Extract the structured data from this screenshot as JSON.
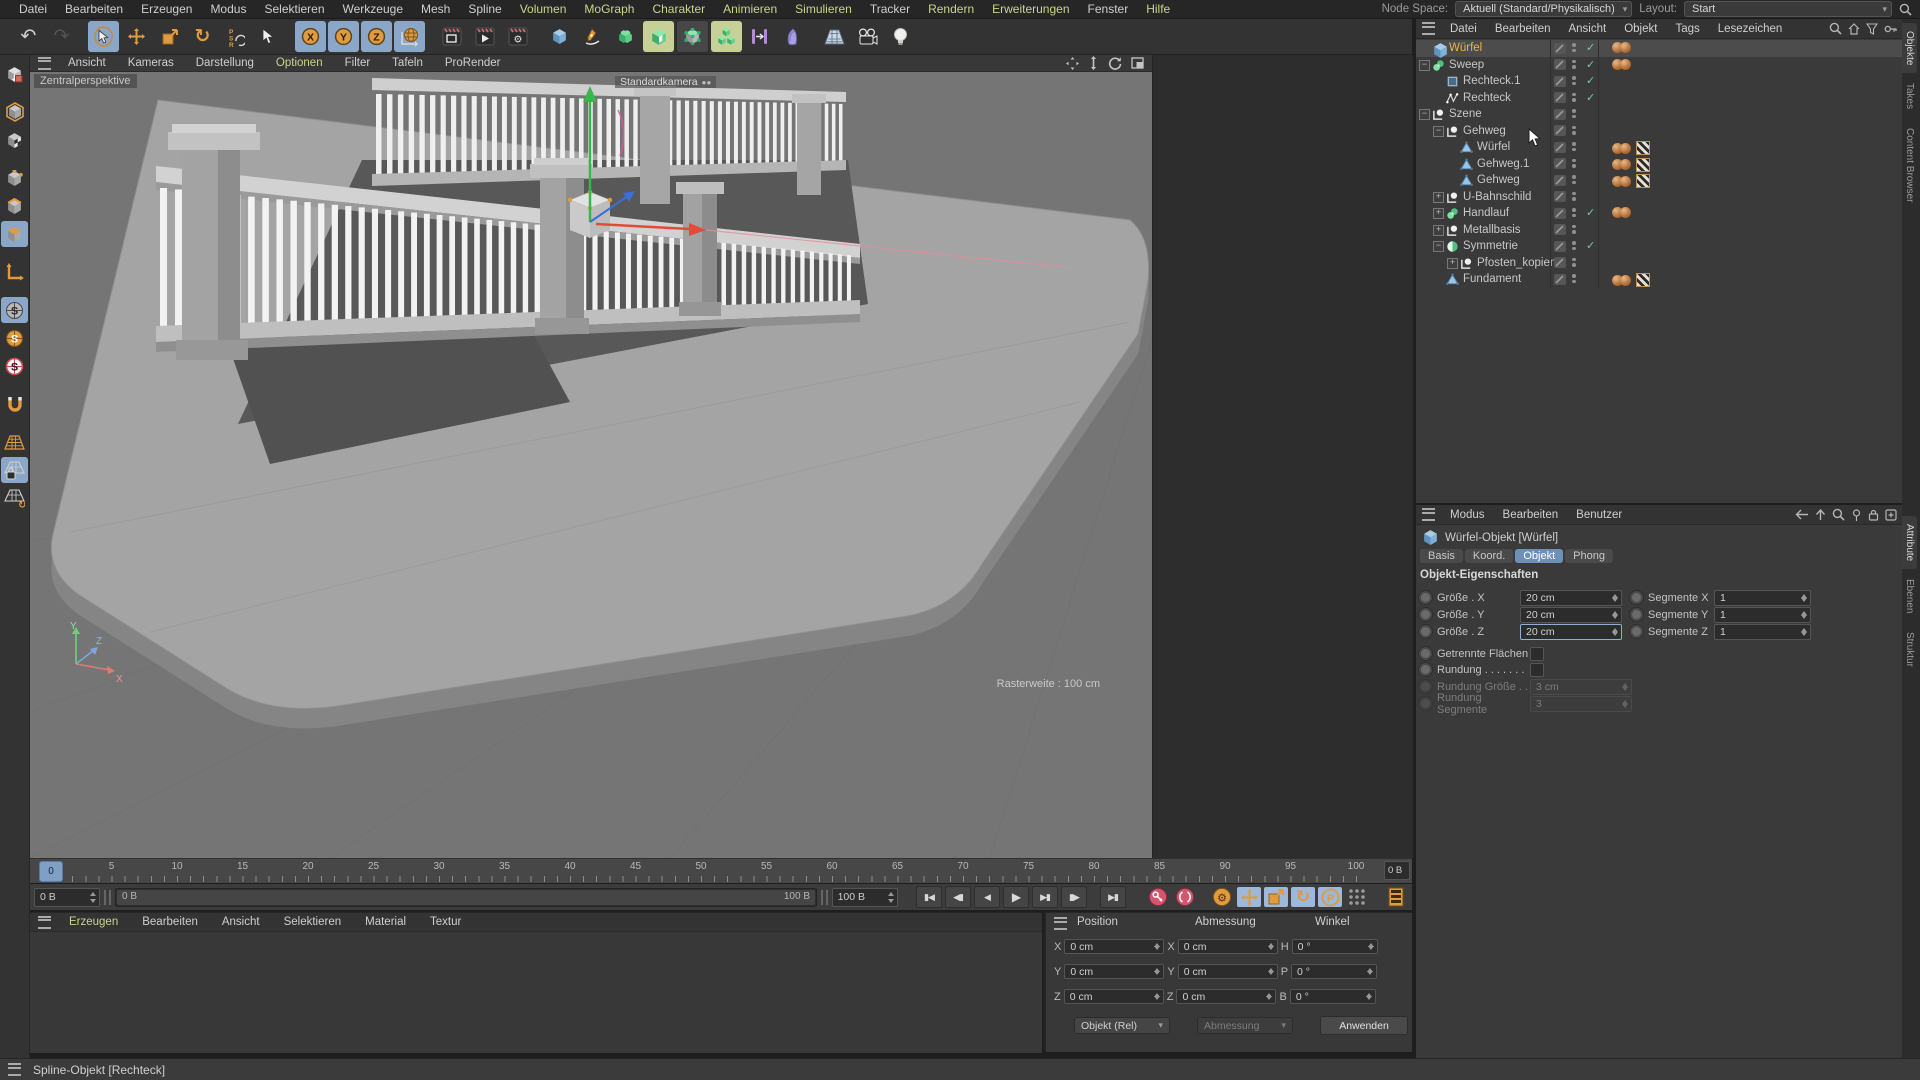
{
  "menubar": {
    "items": [
      {
        "label": "Datei",
        "hl": false
      },
      {
        "label": "Bearbeiten",
        "hl": false
      },
      {
        "label": "Erzeugen",
        "hl": false
      },
      {
        "label": "Modus",
        "hl": false
      },
      {
        "label": "Selektieren",
        "hl": false
      },
      {
        "label": "Werkzeuge",
        "hl": false
      },
      {
        "label": "Mesh",
        "hl": false
      },
      {
        "label": "Spline",
        "hl": false
      },
      {
        "label": "Volumen",
        "hl": true
      },
      {
        "label": "MoGraph",
        "hl": true
      },
      {
        "label": "Charakter",
        "hl": true
      },
      {
        "label": "Animieren",
        "hl": true
      },
      {
        "label": "Simulieren",
        "hl": true
      },
      {
        "label": "Tracker",
        "hl": false
      },
      {
        "label": "Rendern",
        "hl": true
      },
      {
        "label": "Erweiterungen",
        "hl": true
      },
      {
        "label": "Fenster",
        "hl": false
      },
      {
        "label": "Hilfe",
        "hl": true
      }
    ],
    "node_space_label": "Node Space:",
    "node_space_value": "Aktuell (Standard/Physikalisch)",
    "layout_label": "Layout:",
    "layout_value": "Start"
  },
  "toolbar": {
    "buttons": [
      {
        "icon": "undo",
        "name": "undo-button"
      },
      {
        "icon": "redo",
        "name": "redo-button",
        "dim": true
      },
      {
        "sep": true
      },
      {
        "icon": "cursor-ring",
        "name": "live-selection-tool",
        "active": "blue"
      },
      {
        "icon": "move",
        "name": "move-tool"
      },
      {
        "icon": "scale",
        "name": "scale-tool"
      },
      {
        "icon": "rotate",
        "name": "rotate-tool"
      },
      {
        "icon": "psr",
        "name": "psr-tool"
      },
      {
        "icon": "cursor",
        "name": "selection-tool"
      },
      {
        "sep": true
      },
      {
        "icon": "axis-x",
        "name": "lock-x-axis",
        "active": "blue"
      },
      {
        "icon": "axis-y",
        "name": "lock-y-axis",
        "active": "blue"
      },
      {
        "icon": "axis-z",
        "name": "lock-z-axis",
        "active": "blue"
      },
      {
        "icon": "globe",
        "name": "coordinate-system-toggle",
        "active": "blue"
      },
      {
        "sep": true
      },
      {
        "icon": "clapper-frame",
        "name": "render-view-button"
      },
      {
        "icon": "clapper-play",
        "name": "render-picture-viewer-button"
      },
      {
        "icon": "clapper-gear",
        "name": "render-settings-button"
      },
      {
        "sep": true
      },
      {
        "icon": "cube-blue",
        "name": "primitive-object-menu"
      },
      {
        "icon": "pen",
        "name": "spline-pen-menu"
      },
      {
        "icon": "cube-green-handles",
        "name": "generators-menu"
      },
      {
        "icon": "cube-green-open",
        "name": "subdivision-surface-menu",
        "active": "green"
      },
      {
        "icon": "cube-green-dots",
        "name": "deformer-menu",
        "active": "pressed"
      },
      {
        "icon": "cubes-green",
        "name": "mograph-cloner-menu",
        "active": "green"
      },
      {
        "icon": "array-purple",
        "name": "spline-modifier-menu"
      },
      {
        "icon": "bend-purple",
        "name": "bend-deformer-menu"
      },
      {
        "sep": true
      },
      {
        "icon": "floor-grid",
        "name": "environment-floor-menu"
      },
      {
        "icon": "camera",
        "name": "camera-menu"
      },
      {
        "icon": "bulb",
        "name": "light-menu"
      }
    ]
  },
  "left_toolbar": {
    "buttons": [
      {
        "icon": "make-editable",
        "name": "make-editable-button"
      },
      {
        "gap": true
      },
      {
        "icon": "model-mode",
        "name": "model-mode-button"
      },
      {
        "icon": "texture-mode",
        "name": "texture-mode-button"
      },
      {
        "gap": true
      },
      {
        "icon": "point-mode",
        "name": "point-mode-button"
      },
      {
        "icon": "edge-mode",
        "name": "edge-mode-button"
      },
      {
        "icon": "polygon-mode",
        "name": "polygon-mode-button",
        "active": "blue"
      },
      {
        "gap": true
      },
      {
        "icon": "axis-mode",
        "name": "enable-axis-button"
      },
      {
        "gap": true
      },
      {
        "icon": "snap-gray",
        "name": "enable-snap-button",
        "active": "blue"
      },
      {
        "icon": "snap-orange",
        "name": "snap-settings-button"
      },
      {
        "icon": "snap-red",
        "name": "quantize-button"
      },
      {
        "gap": true
      },
      {
        "icon": "magnet",
        "name": "magnet-snap-button"
      },
      {
        "gap": true
      },
      {
        "icon": "workplane",
        "name": "workplane-button"
      },
      {
        "icon": "workplane-lock",
        "name": "lock-workplane-button",
        "active": "blue"
      },
      {
        "icon": "workplane-rotate",
        "name": "align-workplane-button"
      }
    ]
  },
  "viewport": {
    "menu": [
      {
        "label": "Ansicht",
        "hl": false
      },
      {
        "label": "Kameras",
        "hl": false
      },
      {
        "label": "Darstellung",
        "hl": false
      },
      {
        "label": "Optionen",
        "hl": true
      },
      {
        "label": "Filter",
        "hl": false
      },
      {
        "label": "Tafeln",
        "hl": false
      },
      {
        "label": "ProRender",
        "hl": false
      }
    ],
    "corner_icons": [
      "pan-view-icon",
      "dolly-view-icon",
      "rotate-view-icon",
      "toggle-view-icon"
    ],
    "view_label": "Zentralperspektive",
    "camera_label": "Standardkamera",
    "grid_label": "Rasterweite : 100 cm",
    "axis_labels": {
      "x": "X",
      "y": "Y",
      "z": "Z"
    }
  },
  "object_manager": {
    "menu": [
      "Datei",
      "Bearbeiten",
      "Ansicht",
      "Objekt",
      "Tags",
      "Lesezeichen"
    ],
    "right_icons": [
      "search-icon",
      "home-icon",
      "filter-icon",
      "key-icon"
    ],
    "items": [
      {
        "name": "Würfel",
        "depth": 0,
        "icon": "cube",
        "expander": "",
        "selected": true,
        "check": true,
        "tags": [
          "mat",
          "mat"
        ]
      },
      {
        "name": "Sweep",
        "depth": 0,
        "icon": "sweep",
        "expander": "minus",
        "selected": false,
        "check": true,
        "tags": [
          "mat",
          "mat"
        ]
      },
      {
        "name": "Rechteck.1",
        "depth": 1,
        "icon": "rect",
        "expander": "",
        "selected": false,
        "check": true,
        "tags": []
      },
      {
        "name": "Rechteck",
        "depth": 1,
        "icon": "spline",
        "expander": "",
        "selected": false,
        "check": true,
        "tags": []
      },
      {
        "name": "Szene",
        "depth": 0,
        "icon": "null",
        "expander": "minus",
        "selected": false,
        "check": false,
        "tags": []
      },
      {
        "name": "Gehweg",
        "depth": 1,
        "icon": "null",
        "expander": "minus",
        "selected": false,
        "check": false,
        "tags": []
      },
      {
        "name": "Würfel",
        "depth": 2,
        "icon": "poly",
        "expander": "",
        "selected": false,
        "check": false,
        "tags": [
          "mat",
          "mat",
          "checker"
        ]
      },
      {
        "name": "Gehweg.1",
        "depth": 2,
        "icon": "poly",
        "expander": "",
        "selected": false,
        "check": false,
        "tags": [
          "mat",
          "mat",
          "checker"
        ]
      },
      {
        "name": "Gehweg",
        "depth": 2,
        "icon": "poly",
        "expander": "",
        "selected": false,
        "check": false,
        "tags": [
          "mat",
          "mat",
          "checker"
        ]
      },
      {
        "name": "U-Bahnschild",
        "depth": 1,
        "icon": "null",
        "expander": "plus",
        "selected": false,
        "check": false,
        "tags": []
      },
      {
        "name": "Handlauf",
        "depth": 1,
        "icon": "sweep",
        "expander": "plus",
        "selected": false,
        "check": true,
        "tags": [
          "mat",
          "mat"
        ]
      },
      {
        "name": "Metallbasis",
        "depth": 1,
        "icon": "null",
        "expander": "plus",
        "selected": false,
        "check": false,
        "tags": []
      },
      {
        "name": "Symmetrie",
        "depth": 1,
        "icon": "sphere",
        "expander": "minus",
        "selected": false,
        "check": true,
        "tags": []
      },
      {
        "name": "Pfosten_kopien",
        "depth": 2,
        "icon": "null",
        "expander": "plus",
        "selected": false,
        "check": false,
        "tags": []
      },
      {
        "name": "Fundament",
        "depth": 1,
        "icon": "poly",
        "expander": "",
        "selected": false,
        "check": false,
        "tags": [
          "mat",
          "mat",
          "checker"
        ]
      }
    ]
  },
  "attribute_manager": {
    "menu": [
      "Modus",
      "Bearbeiten",
      "Benutzer"
    ],
    "right_icons": [
      "back-arrow-icon",
      "up-arrow-icon",
      "search-icon",
      "pin-icon",
      "lock-icon",
      "new-panel-icon"
    ],
    "title": "Würfel-Objekt [Würfel]",
    "tabs": [
      "Basis",
      "Koord.",
      "Objekt",
      "Phong"
    ],
    "active_tab": "Objekt",
    "section": "Objekt-Eigenschaften",
    "size_rows": [
      {
        "label": "Größe . X",
        "value": "20 cm",
        "label2": "Segmente X",
        "value2": "1",
        "focus": false
      },
      {
        "label": "Größe . Y",
        "value": "20 cm",
        "label2": "Segmente Y",
        "value2": "1",
        "focus": false
      },
      {
        "label": "Größe . Z",
        "value": "20 cm",
        "label2": "Segmente Z",
        "value2": "1",
        "focus": true
      }
    ],
    "checkbox_rows": [
      {
        "label": "Getrennte Flächen",
        "checked": false
      },
      {
        "label": "Rundung . . . . . . .",
        "checked": false
      }
    ],
    "disabled_rows": [
      {
        "label": "Rundung Größe . .",
        "value": "3 cm"
      },
      {
        "label": "Rundung Segmente",
        "value": "3"
      }
    ]
  },
  "timeline": {
    "ticks": [
      0,
      5,
      10,
      15,
      20,
      25,
      30,
      35,
      40,
      45,
      50,
      55,
      60,
      65,
      70,
      75,
      80,
      85,
      90,
      95,
      100
    ],
    "marker_value": "0",
    "frame_box": "0 B",
    "start_field": "0 B",
    "range_left": "0 B",
    "range_right": "100 B",
    "end_field": "100 B",
    "transport": [
      "goto-start-icon",
      "prev-key-icon",
      "prev-frame-icon",
      "play-icon",
      "next-frame-icon",
      "next-key-icon",
      "goto-end-icon"
    ],
    "key_buttons": [
      "record-key-icon",
      "autokey-icon",
      "keyframe-selection-icon",
      "key-position-icon",
      "key-scale-icon",
      "key-rotation-icon",
      "key-parameter-icon",
      "key-pla-icon",
      "timeline-window-icon"
    ]
  },
  "material_manager": {
    "menu": [
      {
        "label": "Erzeugen",
        "hl": true
      },
      {
        "label": "Bearbeiten",
        "hl": false
      },
      {
        "label": "Ansicht",
        "hl": false
      },
      {
        "label": "Selektieren",
        "hl": false
      },
      {
        "label": "Material",
        "hl": false
      },
      {
        "label": "Textur",
        "hl": false
      }
    ]
  },
  "coordinate_manager": {
    "columns": [
      "Position",
      "Abmessung",
      "Winkel"
    ],
    "rows": [
      {
        "a1": "X",
        "pos": "0 cm",
        "a2": "X",
        "dim": "0 cm",
        "a3": "H",
        "ang": "0 °"
      },
      {
        "a1": "Y",
        "pos": "0 cm",
        "a2": "Y",
        "dim": "0 cm",
        "a3": "P",
        "ang": "0 °"
      },
      {
        "a1": "Z",
        "pos": "0 cm",
        "a2": "Z",
        "dim": "0 cm",
        "a3": "B",
        "ang": "0 °"
      }
    ],
    "mode_dropdown": "Objekt (Rel)",
    "dim_dropdown": "Abmessung",
    "apply_label": "Anwenden"
  },
  "right_tabs": {
    "top": [
      {
        "label": "Objekte",
        "active": true
      },
      {
        "label": "Takes",
        "active": false
      },
      {
        "label": "Content Browser",
        "active": false
      }
    ],
    "bottom": [
      {
        "label": "Attribute",
        "active": true
      },
      {
        "label": "Ebenen",
        "active": false
      },
      {
        "label": "Struktur",
        "active": false
      }
    ]
  },
  "status_bar": {
    "text": "Spline-Objekt [Rechteck]"
  },
  "colors": {
    "accent_orange": "#e09a40",
    "highlight_blue": "#8aa7c9",
    "menu_green": "#c9d48b",
    "selected_text": "#e8b54a",
    "check_green": "#74cf9a"
  }
}
